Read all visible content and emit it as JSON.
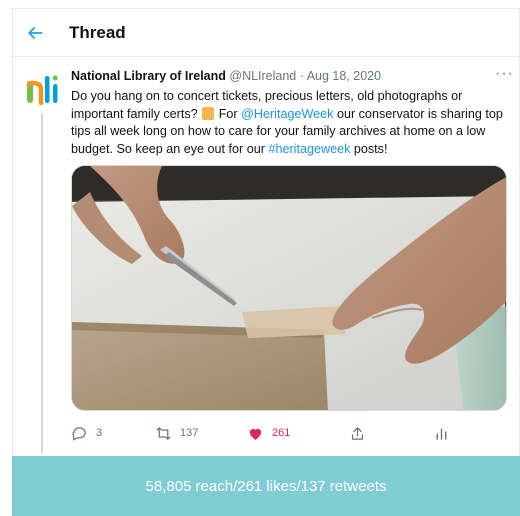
{
  "header": {
    "back_icon": "arrow-left-icon",
    "title": "Thread"
  },
  "tweet": {
    "author_name": "National Library of Ireland",
    "author_handle": "@NLIreland",
    "separator": "·",
    "date": "Aug 18, 2020",
    "more_label": "···",
    "text": {
      "part1": "Do you hang on to concert tickets, precious letters, old photographs or important family certs?",
      "emoji": "scroll-emoji",
      "part2": "For",
      "mention": "@HeritageWeek",
      "part3": "our conservator is sharing top tips all week long on how to care for your family archives at home on a low budget. So keep an eye out for our",
      "hashtag": "#heritageweek",
      "part4": "posts!"
    },
    "media_icon": "photo-hands-tweezers-paper",
    "actions": {
      "reply_count": "3",
      "retweet_count": "137",
      "like_count": "261",
      "share_icon": "share-icon",
      "analytics_icon": "analytics-icon"
    }
  },
  "footer": {
    "stats": "58,805 reach/261 likes/137 retweets"
  },
  "colors": {
    "accent": "#1da1f2",
    "link": "#1b95e0",
    "like": "#e0245e",
    "footer_band": "#7fcdd3",
    "logo_green": "#72bf44",
    "logo_orange": "#f7941d",
    "logo_blue": "#00a0dd"
  }
}
